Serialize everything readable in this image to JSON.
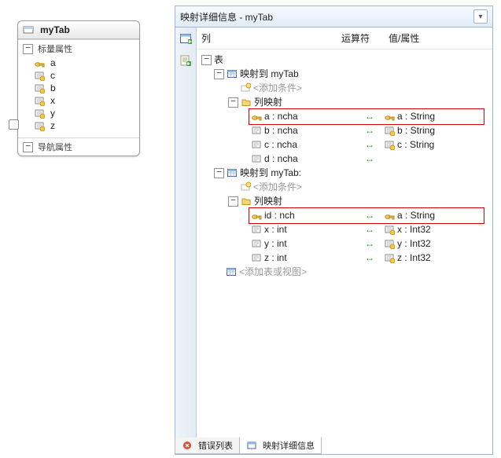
{
  "entity": {
    "title": "myTab",
    "section_scalar": "标量属性",
    "section_nav": "导航属性",
    "props": [
      "a",
      "c",
      "b",
      "x",
      "y",
      "z"
    ]
  },
  "panel": {
    "title": "映射详细信息 - myTab",
    "columns": {
      "col": "列",
      "op": "运算符",
      "val": "值/属性"
    },
    "root": "表",
    "map_prefix": "映射到 ",
    "map_target_1": "myTab",
    "map_target_2": "myTab:",
    "add_condition": "<添加条件>",
    "col_mapping": "列映射",
    "add_table": "<添加表或视图>",
    "mappings1": [
      {
        "left": "a : ncha",
        "right": "a : String",
        "lkey": true,
        "rkey": true
      },
      {
        "left": "b : ncha",
        "right": "b : String",
        "lkey": false,
        "rkey": false
      },
      {
        "left": "c : ncha",
        "right": "c : String",
        "lkey": false,
        "rkey": false
      },
      {
        "left": "d : ncha",
        "right": "",
        "lkey": false,
        "rkey": false
      }
    ],
    "mappings2": [
      {
        "left": "id : nch",
        "right": "a : String",
        "lkey": true,
        "rkey": true
      },
      {
        "left": "x : int",
        "right": "x : Int32",
        "lkey": false,
        "rkey": false
      },
      {
        "left": "y : int",
        "right": "y : Int32",
        "lkey": false,
        "rkey": false
      },
      {
        "left": "z : int",
        "right": "z : Int32",
        "lkey": false,
        "rkey": false
      }
    ]
  },
  "tabs": {
    "error": "错误列表",
    "detail": "映射详细信息"
  }
}
